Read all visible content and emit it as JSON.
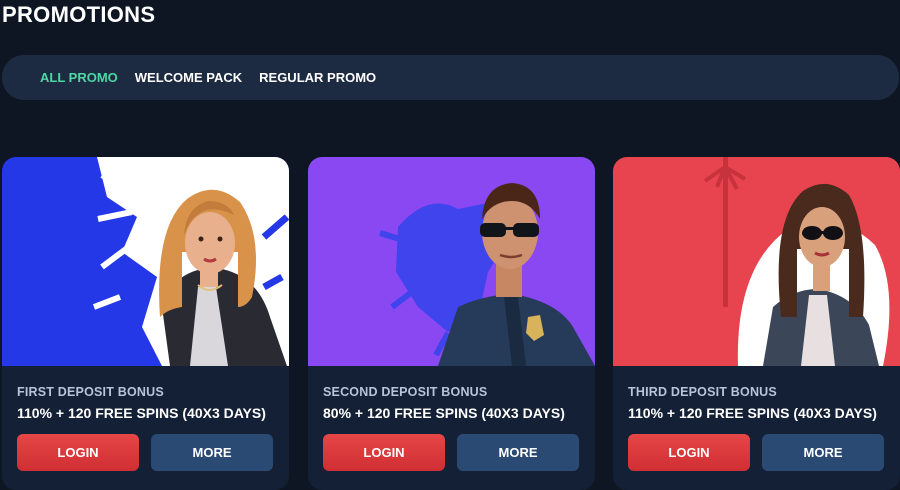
{
  "page": {
    "title": "PROMOTIONS"
  },
  "tabs": [
    {
      "label": "ALL PROMO",
      "active": true
    },
    {
      "label": "WELCOME PACK",
      "active": false
    },
    {
      "label": "REGULAR PROMO",
      "active": false
    }
  ],
  "cards": [
    {
      "subtitle": "FIRST DEPOSIT BONUS",
      "offer": "110% + 120 FREE SPINS (40X3 DAYS)",
      "login_label": "LOGIN",
      "more_label": "MORE"
    },
    {
      "subtitle": "SECOND DEPOSIT BONUS",
      "offer": "80% + 120 FREE SPINS (40X3 DAYS)",
      "login_label": "LOGIN",
      "more_label": "MORE"
    },
    {
      "subtitle": "THIRD DEPOSIT BONUS",
      "offer": "110% + 120 FREE SPINS (40X3 DAYS)",
      "login_label": "LOGIN",
      "more_label": "MORE"
    }
  ],
  "colors": {
    "background": "#0e1624",
    "tabbar": "#1d2b42",
    "active_tab": "#4fd6a3",
    "card": "#142036",
    "login_button": "#d9383c",
    "more_button": "#2b4a73"
  }
}
